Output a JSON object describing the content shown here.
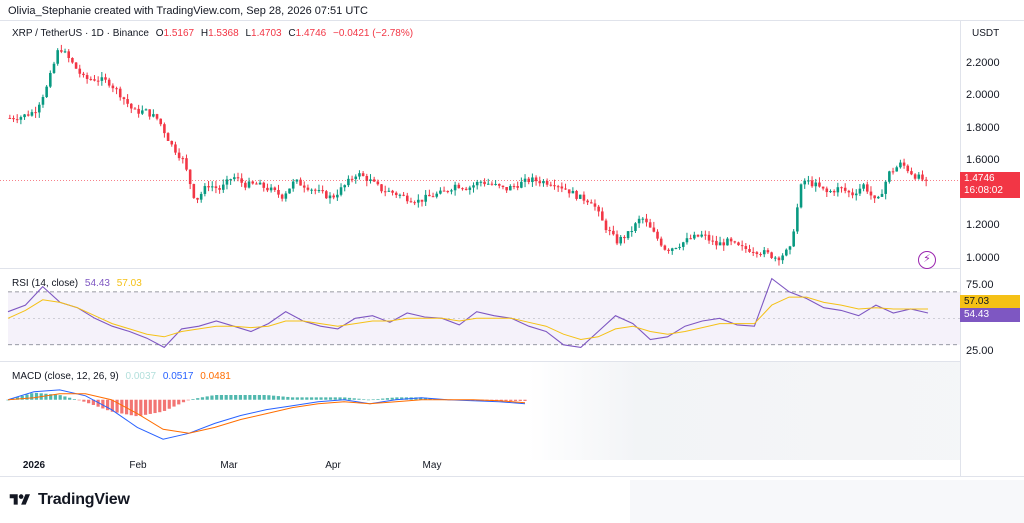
{
  "credit": "Olivia_Stephanie created with TradingView.com, Sep 28, 2026 07:51 UTC",
  "legend": {
    "symbol": "XRP / TetherUS · 1D · Binance",
    "o_label": "O",
    "o_value": "1.5167",
    "h_label": "H",
    "h_value": "1.5368",
    "l_label": "L",
    "l_value": "1.4703",
    "c_label": "C",
    "c_value": "1.4746",
    "change": "−0.0421 (−2.78%)"
  },
  "rsi_legend": {
    "label": "RSI (14, close)",
    "value": "54.43",
    "ma": "57.03"
  },
  "macd_legend": {
    "label": "MACD (close, 12, 26, 9)",
    "hist": "0.0037",
    "macd": "0.0517",
    "signal": "0.0481"
  },
  "currency": "USDT",
  "price_tag": "1.4746",
  "countdown": "16:08:02",
  "rsi_tags": {
    "ma": "57.03",
    "rsi": "54.43"
  },
  "brand": "TradingView",
  "icons": {
    "logo": "tradingview-logo-icon",
    "flash": "lightning-icon"
  },
  "colors": {
    "up": "#089981",
    "down": "#f23645",
    "rsi": "#7e57c2",
    "rsi_ma": "#f5c116",
    "macd": "#2962ff",
    "signal": "#ff6d00"
  },
  "chart_data": [
    {
      "type": "candlestick",
      "title": "XRP / TetherUS · 1D · Binance",
      "ylim": [
        0.95,
        2.45
      ],
      "y_ticks": [
        "2.2000",
        "2.0000",
        "1.8000",
        "1.6000",
        "1.2000",
        "1.0000"
      ],
      "x_ticks": [
        "2026",
        "Feb",
        "Mar",
        "Apr",
        "May"
      ],
      "close_path": [
        1.86,
        1.87,
        1.9,
        2.05,
        2.3,
        2.2,
        2.1,
        2.1,
        2.08,
        2.0,
        1.9,
        1.9,
        1.85,
        1.7,
        1.6,
        1.35,
        1.45,
        1.42,
        1.5,
        1.45,
        1.45,
        1.42,
        1.38,
        1.47,
        1.44,
        1.4,
        1.37,
        1.44,
        1.52,
        1.48,
        1.42,
        1.4,
        1.37,
        1.35,
        1.38,
        1.4,
        1.45,
        1.43,
        1.47,
        1.45,
        1.42,
        1.45,
        1.48,
        1.47,
        1.46,
        1.42,
        1.37,
        1.35,
        1.2,
        1.1,
        1.15,
        1.25,
        1.15,
        1.05,
        1.08,
        1.12,
        1.14,
        1.08,
        1.1,
        1.06,
        1.05,
        1.03,
        1.0,
        1.05,
        1.48,
        1.45,
        1.4,
        1.43,
        1.39,
        1.45,
        1.33,
        1.52,
        1.58,
        1.51,
        1.47
      ]
    },
    {
      "type": "line",
      "title": "RSI (14, close)",
      "ylim": [
        20,
        85
      ],
      "y_ticks": [
        "75.00",
        "25.00"
      ],
      "series": [
        {
          "name": "RSI",
          "values": [
            55,
            60,
            74,
            62,
            58,
            50,
            44,
            40,
            35,
            28,
            42,
            44,
            48,
            44,
            40,
            46,
            55,
            48,
            44,
            42,
            50,
            52,
            47,
            54,
            51,
            50,
            45,
            55,
            52,
            50,
            44,
            40,
            30,
            28,
            40,
            52,
            46,
            34,
            36,
            44,
            48,
            50,
            45,
            44,
            80,
            70,
            65,
            58,
            56,
            52,
            60,
            54,
            57,
            54
          ]
        },
        {
          "name": "MA",
          "values": [
            50,
            56,
            64,
            62,
            58,
            52,
            46,
            42,
            38,
            36,
            40,
            42,
            44,
            44,
            43,
            44,
            48,
            48,
            46,
            44,
            46,
            48,
            48,
            50,
            50,
            50,
            48,
            50,
            50,
            50,
            47,
            44,
            38,
            34,
            36,
            42,
            44,
            40,
            38,
            40,
            43,
            46,
            46,
            46,
            60,
            66,
            66,
            62,
            60,
            57,
            58,
            57,
            57,
            57
          ]
        }
      ]
    },
    {
      "type": "bar",
      "title": "MACD (close, 12, 26, 9)",
      "ylim": [
        -0.28,
        0.1
      ],
      "series": [
        {
          "name": "MACD",
          "values": [
            0.0,
            0.04,
            0.05,
            0.02,
            -0.05,
            -0.14,
            -0.2,
            -0.17,
            -0.12,
            -0.08,
            -0.05,
            -0.03,
            -0.01,
            0.0,
            -0.02,
            0.0,
            0.01,
            0.0,
            -0.005,
            -0.01,
            -0.02
          ]
        },
        {
          "name": "Signal",
          "values": [
            0.0,
            0.01,
            0.03,
            0.03,
            0.0,
            -0.07,
            -0.15,
            -0.17,
            -0.14,
            -0.1,
            -0.07,
            -0.04,
            -0.02,
            -0.01,
            -0.02,
            -0.01,
            0.0,
            0.0,
            0.0,
            -0.005,
            -0.015
          ]
        }
      ]
    }
  ]
}
